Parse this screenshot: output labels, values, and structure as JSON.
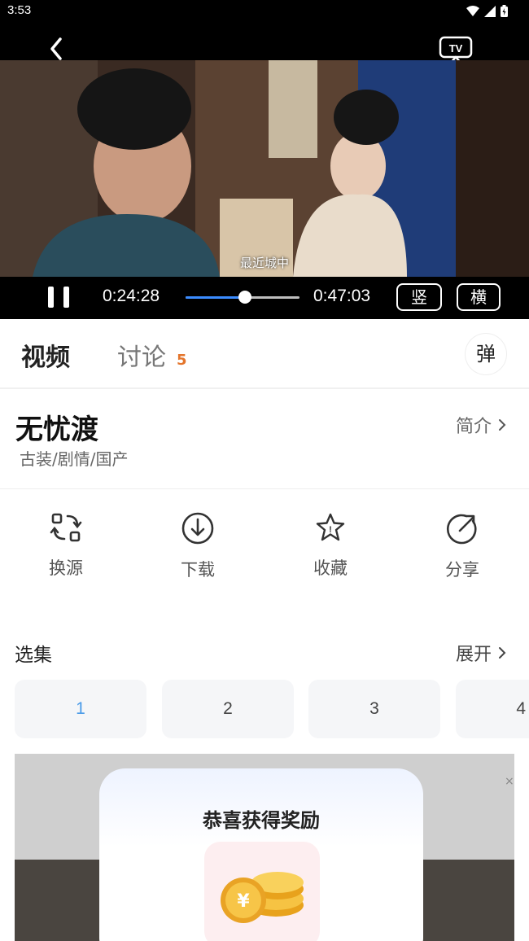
{
  "status_bar": {
    "time": "3:53"
  },
  "player": {
    "subtitle": "最近城中",
    "current_time": "0:24:28",
    "total_time": "0:47:03",
    "progress_fraction": 0.52,
    "vertical_label": "竖",
    "horizontal_label": "横"
  },
  "tabs": {
    "video": "视频",
    "discuss": "讨论",
    "discuss_count": "5",
    "danmaku": "弹"
  },
  "show": {
    "title": "无忧渡",
    "genres": "古装/剧情/国产",
    "intro_label": "简介"
  },
  "actions": [
    {
      "label": "换源",
      "icon": "switch-source-icon"
    },
    {
      "label": "下载",
      "icon": "download-icon"
    },
    {
      "label": "收藏",
      "icon": "star-icon"
    },
    {
      "label": "分享",
      "icon": "share-icon"
    }
  ],
  "episodes": {
    "header": "选集",
    "expand_label": "展开",
    "items": [
      "1",
      "2",
      "3",
      "4"
    ],
    "selected": "1"
  },
  "ad": {
    "close": "×",
    "popup_title": "恭喜获得奖励"
  },
  "colors": {
    "accent_blue": "#4a9be8",
    "progress_blue": "#3b8cff",
    "badge_orange": "#e4752c"
  }
}
